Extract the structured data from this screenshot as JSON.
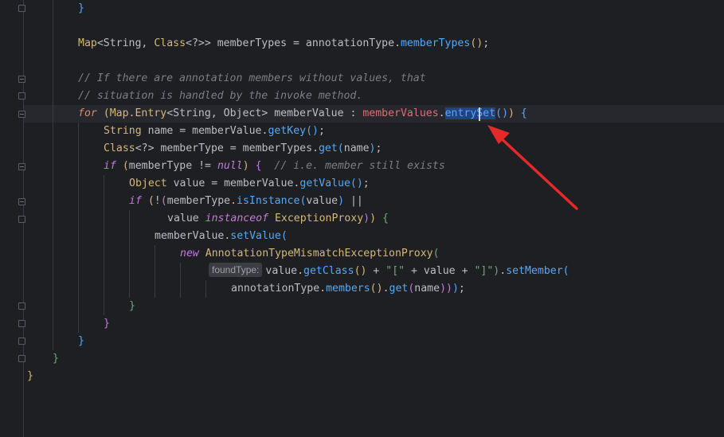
{
  "editor": {
    "lines": {
      "l01": {
        "brace": "}"
      },
      "l03": {
        "type_map": "Map",
        "lt": "<",
        "type_string": "String",
        "comma": ", ",
        "type_class": "Class",
        "generic": "<?>>",
        "var": " memberTypes = annotationType.",
        "method": "memberTypes",
        "call": "()",
        "semi": ";"
      },
      "l05": {
        "comment": "// If there are annotation members without values, that"
      },
      "l06": {
        "comment": "// situation is handled by the invoke method."
      },
      "l07": {
        "kw_for": "for",
        "p_open": " (",
        "type": "Map.Entry",
        "lt": "<",
        "t1": "String",
        "comma": ", ",
        "t2": "Object",
        "gt": ">",
        "var": " memberValue : ",
        "field": "memberValues",
        "dot": ".",
        "method_a": "entry",
        "method_b": "Set",
        "call": "()",
        "p_close": ")",
        "brace": " {"
      },
      "l08": {
        "type": "String",
        "rest": " name = memberValue.",
        "method": "getKey",
        "call": "()",
        "semi": ";"
      },
      "l09": {
        "type": "Class",
        "generic": "<?>",
        "rest": " memberType = memberTypes.",
        "method": "get",
        "p_open": "(",
        "arg": "name",
        "p_close": ")",
        "semi": ";"
      },
      "l10": {
        "kw_if": "if",
        "p_open": " (",
        "rest": "memberType != ",
        "kw_null": "null",
        "p_close": ")",
        "brace": " {",
        "comment": "  // i.e. member still exists"
      },
      "l11": {
        "type": "Object",
        "rest": " value = memberValue.",
        "method": "getValue",
        "call": "()",
        "semi": ";"
      },
      "l12": {
        "kw_if": "if",
        "p_open": " (",
        "bang": "!",
        "p2": "(",
        "rest": "memberType.",
        "method": "isInstance",
        "p3o": "(",
        "arg": "value",
        "p3c": ")",
        "op": " ||"
      },
      "l13": {
        "rest": "value ",
        "kw": "instanceof",
        "type": " ExceptionProxy",
        "p2c": ")",
        "p1c": ")",
        "brace": " {"
      },
      "l14": {
        "rest": "memberValue.",
        "method": "setValue",
        "p_open": "("
      },
      "l15": {
        "kw_new": "new",
        "type": " AnnotationTypeMismatchExceptionProxy",
        "p_open": "("
      },
      "l16": {
        "hint": "foundType:",
        "rest": "value.",
        "method": "getClass",
        "call": "()",
        "plus1": " + ",
        "s1": "\"[\"",
        "plus2": " + value + ",
        "s2": "\"]\"",
        "p_close": ")",
        "dot": ".",
        "method2": "setMember",
        "p_open": "("
      },
      "l17": {
        "rest": "annotationType.",
        "method": "members",
        "call": "()",
        "dot": ".",
        "method2": "get",
        "p_open": "(",
        "arg": "name",
        "p_close": "))",
        "close2": ")",
        "semi": ";"
      },
      "l18": {
        "brace": "}"
      },
      "l19": {
        "brace": "}"
      },
      "l20": {
        "brace": "}"
      },
      "l21": {
        "brace": "}"
      },
      "l22": {
        "brace": "}"
      }
    }
  },
  "colors": {
    "background": "#1e1f22",
    "arrow": "#e5282a",
    "keyword": "#cf8e6d",
    "method": "#56a8f5",
    "comment": "#7a7e85"
  }
}
